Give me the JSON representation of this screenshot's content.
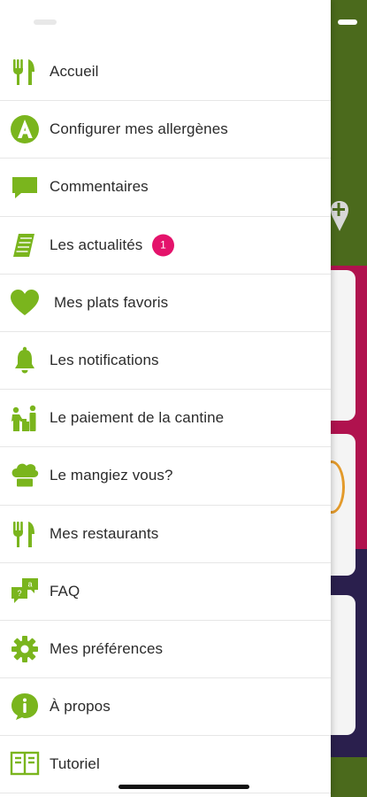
{
  "colors": {
    "accent": "#7ab51d",
    "badge": "#e4136b",
    "text": "#2b2b2b"
  },
  "menu": {
    "items": [
      {
        "label": "Accueil",
        "icon": "fork-knife-icon"
      },
      {
        "label": "Configurer mes allergènes",
        "icon": "allergen-a-icon"
      },
      {
        "label": "Commentaires",
        "icon": "speech-bubble-icon"
      },
      {
        "label": "Les actualités",
        "icon": "newspaper-icon",
        "badge": "1"
      },
      {
        "label": "Mes plats favoris",
        "icon": "heart-icon"
      },
      {
        "label": "Les notifications",
        "icon": "bell-icon"
      },
      {
        "label": "Le paiement de la cantine",
        "icon": "cashier-icon"
      },
      {
        "label": "Le mangiez vous?",
        "icon": "chef-hat-icon"
      },
      {
        "label": "Mes restaurants",
        "icon": "fork-knife-icon"
      },
      {
        "label": "FAQ",
        "icon": "faq-bubbles-icon"
      },
      {
        "label": "Mes préférences",
        "icon": "gear-icon"
      },
      {
        "label": "À propos",
        "icon": "info-icon"
      },
      {
        "label": "Tutoriel",
        "icon": "tutorial-icon"
      }
    ]
  }
}
